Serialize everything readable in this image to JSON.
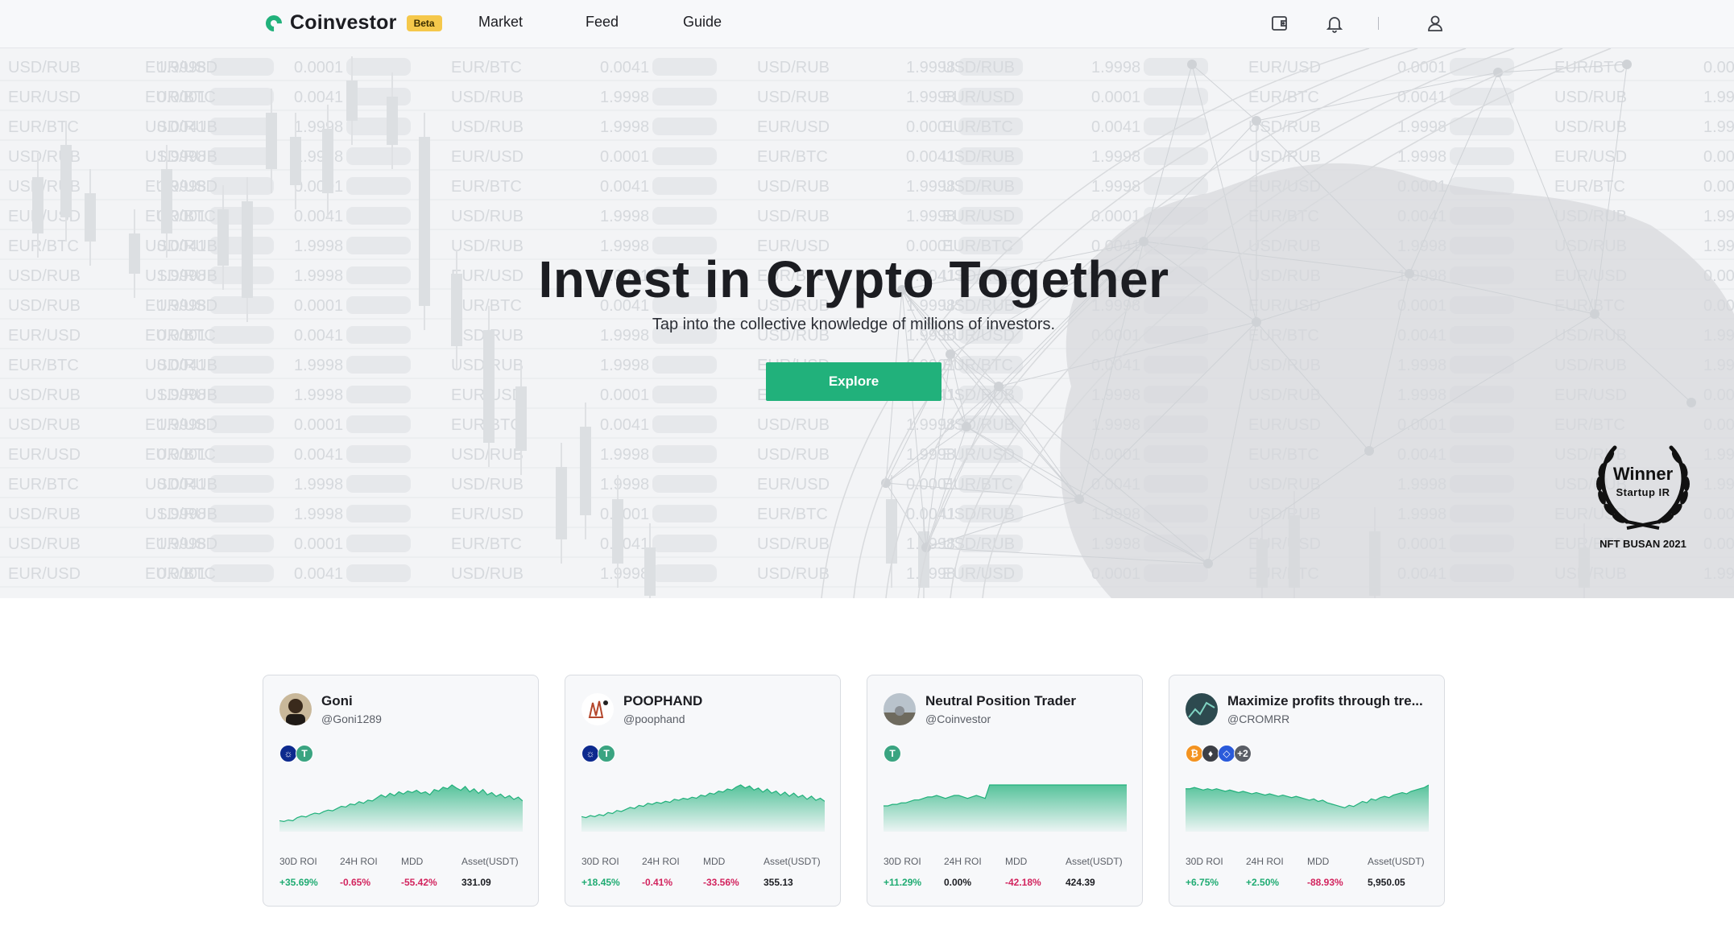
{
  "header": {
    "logo_text": "Coinvestor",
    "beta_label": "Beta",
    "nav": [
      "Market",
      "Feed",
      "Guide"
    ],
    "icons": [
      "wallet-icon",
      "bell-icon",
      "user-icon"
    ],
    "divider_text": "|"
  },
  "hero": {
    "title": "Invest in Crypto Together",
    "subtitle": "Tap into the collective knowledge of millions of investors.",
    "explore_label": "Explore",
    "award": {
      "winner": "Winner",
      "category": "Startup IR",
      "event": "NFT BUSAN 2021"
    }
  },
  "colors": {
    "accent": "#21b17b",
    "positive": "#1fab72",
    "negative": "#d2245e",
    "beta": "#f5c84b"
  },
  "stat_labels": [
    "30D ROI",
    "24H ROI",
    "MDD",
    "Asset(USDT)"
  ],
  "cards": [
    {
      "name": "Goni",
      "handle": "@Goni1289",
      "coins": [
        {
          "symbol": "ADA",
          "glyph": "☼",
          "color": "#0d2a8e"
        },
        {
          "symbol": "USDT",
          "glyph": "T",
          "color": "#3aa481"
        }
      ],
      "roi_30d": "+35.69%",
      "roi_24h": "-0.65%",
      "mdd": "-55.42%",
      "asset": "331.09",
      "trend": [
        8,
        7,
        9,
        8,
        12,
        14,
        13,
        16,
        18,
        17,
        20,
        22,
        21,
        24,
        27,
        26,
        30,
        29,
        33,
        31,
        35,
        34,
        38,
        42,
        39,
        44,
        41,
        46,
        43,
        47,
        45,
        48,
        44,
        46,
        42,
        49,
        47,
        52,
        50,
        55,
        51,
        48,
        53,
        46,
        50,
        44,
        49,
        42,
        45,
        40,
        43,
        38,
        41,
        36,
        39,
        34
      ]
    },
    {
      "name": "POOPHAND",
      "handle": "@poophand",
      "coins": [
        {
          "symbol": "ADA",
          "glyph": "☼",
          "color": "#0d2a8e"
        },
        {
          "symbol": "USDT",
          "glyph": "T",
          "color": "#3aa481"
        }
      ],
      "roi_30d": "+18.45%",
      "roi_24h": "-0.41%",
      "mdd": "-33.56%",
      "asset": "355.13",
      "trend": [
        10,
        9,
        11,
        10,
        12,
        11,
        14,
        13,
        16,
        15,
        17,
        19,
        18,
        21,
        20,
        23,
        22,
        24,
        23,
        25,
        24,
        27,
        26,
        28,
        27,
        29,
        28,
        31,
        30,
        33,
        32,
        35,
        34,
        37,
        36,
        39,
        41,
        38,
        40,
        36,
        38,
        34,
        37,
        33,
        35,
        31,
        34,
        30,
        33,
        29,
        31,
        27,
        30,
        26,
        28,
        25
      ]
    },
    {
      "name": "Neutral Position Trader",
      "handle": "@Coinvestor",
      "coins": [
        {
          "symbol": "USDT",
          "glyph": "T",
          "color": "#3aa481"
        }
      ],
      "roi_30d": "+11.29%",
      "roi_24h": "0.00%",
      "mdd": "-42.18%",
      "asset": "424.39",
      "trend": [
        14,
        14,
        15,
        15,
        16,
        16,
        17,
        18,
        18,
        19,
        20,
        20,
        21,
        20,
        19,
        20,
        21,
        21,
        20,
        19,
        20,
        21,
        20,
        19,
        28,
        28,
        28,
        28,
        28,
        28,
        28,
        28,
        28,
        28,
        28,
        28,
        28,
        28,
        28,
        28,
        28,
        28,
        28,
        28,
        28,
        28,
        28,
        28,
        28,
        28,
        28,
        28,
        28,
        28,
        28,
        28
      ]
    },
    {
      "name": "Maximize profits through tre...",
      "handle": "@CROMRR",
      "coins": [
        {
          "symbol": "BTC",
          "glyph": "₿",
          "color": "#f39321"
        },
        {
          "symbol": "ETH",
          "glyph": "♦",
          "color": "#3c3f46"
        },
        {
          "symbol": "LINK",
          "glyph": "◇",
          "color": "#2a5ada"
        },
        {
          "symbol": "more",
          "glyph": "+2",
          "color": "#5a5e66"
        }
      ],
      "roi_30d": "+6.75%",
      "roi_24h": "+2.50%",
      "mdd": "-88.93%",
      "asset": "5,950.05",
      "trend": [
        30,
        30,
        31,
        30,
        29,
        30,
        29,
        30,
        29,
        28,
        29,
        28,
        27,
        28,
        27,
        26,
        27,
        26,
        25,
        26,
        25,
        24,
        25,
        24,
        23,
        24,
        23,
        22,
        21,
        22,
        20,
        21,
        19,
        18,
        17,
        16,
        15,
        17,
        16,
        18,
        20,
        19,
        22,
        21,
        23,
        24,
        23,
        25,
        26,
        27,
        26,
        28,
        29,
        30,
        31,
        33
      ]
    }
  ]
}
